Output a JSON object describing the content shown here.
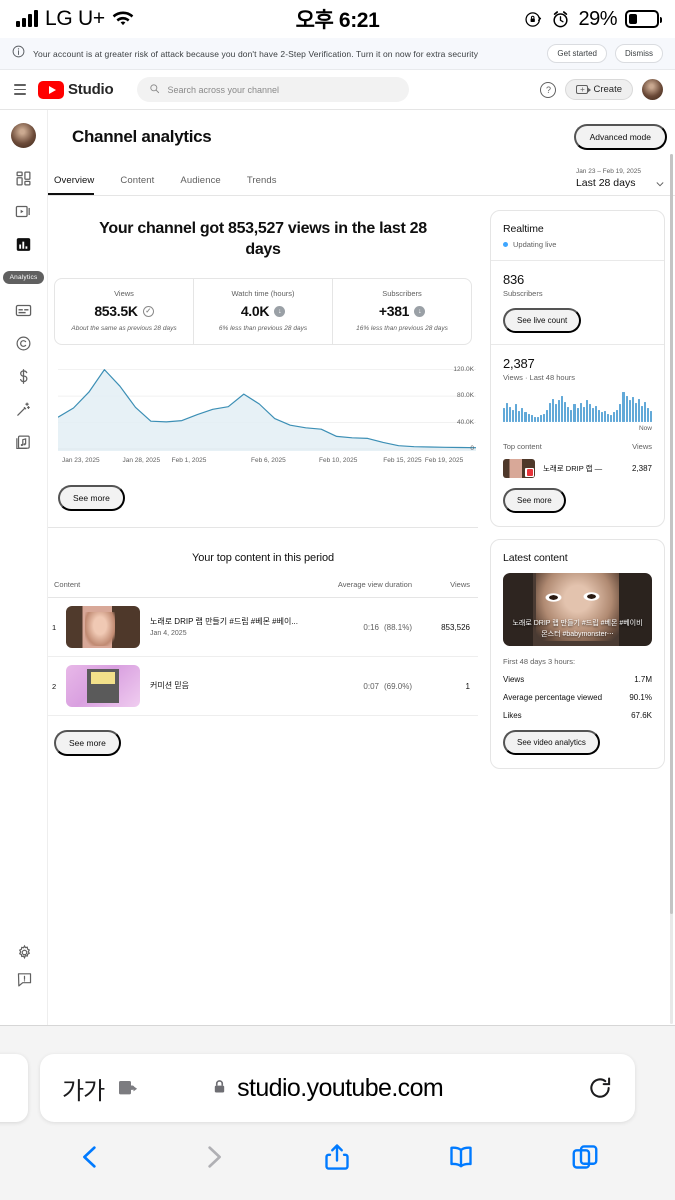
{
  "status_bar": {
    "carrier": "LG U+",
    "time": "오후 6:21",
    "battery_percent": "29%",
    "icons": [
      "signal-bars-icon",
      "wifi-icon",
      "rotation-lock-icon",
      "alarm-clock-icon",
      "battery-icon"
    ]
  },
  "security_banner": {
    "message": "Your account is at greater risk of attack because you don't have 2-Step Verification. Turn it on now for extra security",
    "get_started_label": "Get started",
    "dismiss_label": "Dismiss"
  },
  "studio_header": {
    "logo_text": "Studio",
    "search_placeholder": "Search across your channel",
    "search_value": "",
    "create_label": "Create"
  },
  "sidebar": {
    "items": [
      {
        "name": "avatar",
        "label": ""
      },
      {
        "name": "dashboard",
        "label": ""
      },
      {
        "name": "content",
        "label": ""
      },
      {
        "name": "analytics",
        "label": "",
        "active": true
      },
      {
        "name": "analytics-tooltip",
        "label": "Analytics"
      },
      {
        "name": "subtitles",
        "label": ""
      },
      {
        "name": "copyright",
        "label": ""
      },
      {
        "name": "earn",
        "label": ""
      },
      {
        "name": "customization",
        "label": ""
      },
      {
        "name": "audio-library",
        "label": ""
      }
    ],
    "bottom": [
      {
        "name": "settings",
        "label": ""
      },
      {
        "name": "send-feedback",
        "label": ""
      }
    ],
    "tooltip_label": "Analytics"
  },
  "page": {
    "title": "Channel analytics",
    "advanced_mode_label": "Advanced mode",
    "tabs": [
      {
        "label": "Overview",
        "active": true
      },
      {
        "label": "Content",
        "active": false
      },
      {
        "label": "Audience",
        "active": false
      },
      {
        "label": "Trends",
        "active": false
      }
    ],
    "date_range_small": "Jan 23 – Feb 19, 2025",
    "date_range_main": "Last 28 days"
  },
  "overview": {
    "hero_headline": "Your channel got 853,527 views in the last 28 days",
    "metrics": [
      {
        "label": "Views",
        "value": "853.5K",
        "badge": "check-icon",
        "comparison": "About the same as previous 28 days"
      },
      {
        "label": "Watch time (hours)",
        "value": "4.0K",
        "badge": "arrow-down-icon",
        "comparison": "6% less than previous 28 days"
      },
      {
        "label": "Subscribers",
        "value": "+381",
        "badge": "arrow-down-icon",
        "comparison": "16% less than previous 28 days"
      }
    ],
    "see_more_label": "See more"
  },
  "chart_data": {
    "type": "area",
    "title": "Views over the last 28 days",
    "xlabel": "",
    "ylabel": "Views",
    "ylim": [
      0,
      130000
    ],
    "grid": true,
    "legend": "none",
    "ytick_labels": [
      "120.0K",
      "80.0K",
      "40.0K",
      "0"
    ],
    "ytick_values": [
      120000,
      80000,
      40000,
      0
    ],
    "xtick_labels": [
      "Jan 23, 2025",
      "Jan 28, 2025",
      "Feb 1, 2025",
      "Feb 6, 2025",
      "Feb 10, 2025",
      "Feb 15, 2025",
      "Feb 19, 2025"
    ],
    "x": [
      "Jan 23",
      "Jan 24",
      "Jan 25",
      "Jan 26",
      "Jan 27",
      "Jan 28",
      "Jan 29",
      "Jan 30",
      "Jan 31",
      "Feb 1",
      "Feb 2",
      "Feb 3",
      "Feb 4",
      "Feb 5",
      "Feb 6",
      "Feb 7",
      "Feb 8",
      "Feb 9",
      "Feb 10",
      "Feb 11",
      "Feb 12",
      "Feb 13",
      "Feb 14",
      "Feb 15",
      "Feb 16",
      "Feb 17",
      "Feb 18",
      "Feb 19"
    ],
    "values": [
      48000,
      62000,
      86000,
      120000,
      95000,
      63000,
      42000,
      41000,
      43000,
      52000,
      60000,
      64000,
      83000,
      68000,
      46000,
      36000,
      32000,
      30000,
      19000,
      17000,
      16000,
      10000,
      5000,
      3500,
      3000,
      2500,
      2200,
      2000
    ],
    "line_color": "#3c8fb5",
    "fill_color": "#e3eff5"
  },
  "top_content": {
    "title": "Your top content in this period",
    "columns": [
      "Content",
      "Average view duration",
      "Views"
    ],
    "rows": [
      {
        "rank": "1",
        "title": "노래로 DRIP 랩 만들기 #드립 #베몬 #베이...",
        "date": "Jan 4, 2025",
        "avg_view_duration": "0:16",
        "avg_view_percent": "(88.1%)",
        "views": "853,526"
      },
      {
        "rank": "2",
        "title": "커미션 믿음",
        "date": "",
        "avg_view_duration": "0:07",
        "avg_view_percent": "(69.0%)",
        "views": "1"
      }
    ],
    "see_more_label": "See more"
  },
  "realtime": {
    "title": "Realtime",
    "live_status": "Updating live",
    "subscribers_count": "836",
    "subscribers_label": "Subscribers",
    "see_live_count_label": "See live count",
    "views_count": "2,387",
    "views_label": "Views · Last 48 hours",
    "now_label": "Now",
    "top_content_header": "Top content",
    "views_header": "Views",
    "top_row": {
      "title": "노래로 DRIP 랩 —",
      "views": "2,387"
    },
    "see_more_label": "See more",
    "sparkline": [
      10,
      14,
      11,
      9,
      13,
      8,
      10,
      7,
      6,
      5,
      4,
      4,
      5,
      6,
      9,
      14,
      17,
      13,
      16,
      19,
      15,
      11,
      9,
      13,
      10,
      14,
      11,
      16,
      13,
      10,
      12,
      9,
      7,
      8,
      6,
      5,
      7,
      9,
      13,
      22,
      19,
      16,
      18,
      14,
      17,
      12,
      15,
      10,
      8
    ]
  },
  "latest_content": {
    "title": "Latest content",
    "video_caption": "노래로 DRIP 랩 만들기 #드립 #베몬 #베이비몬스터 #babymonster⋯",
    "first_period_label": "First 48 days 3 hours:",
    "stats": [
      {
        "label": "Views",
        "value": "1.7M"
      },
      {
        "label": "Average percentage viewed",
        "value": "90.1%"
      },
      {
        "label": "Likes",
        "value": "67.6K"
      }
    ],
    "see_video_analytics_label": "See video analytics"
  },
  "browser": {
    "aa_label": "가가",
    "url": "studio.youtube.com",
    "nav_icons": [
      "back-icon",
      "forward-icon",
      "share-icon",
      "bookmarks-icon",
      "tabs-icon"
    ]
  }
}
